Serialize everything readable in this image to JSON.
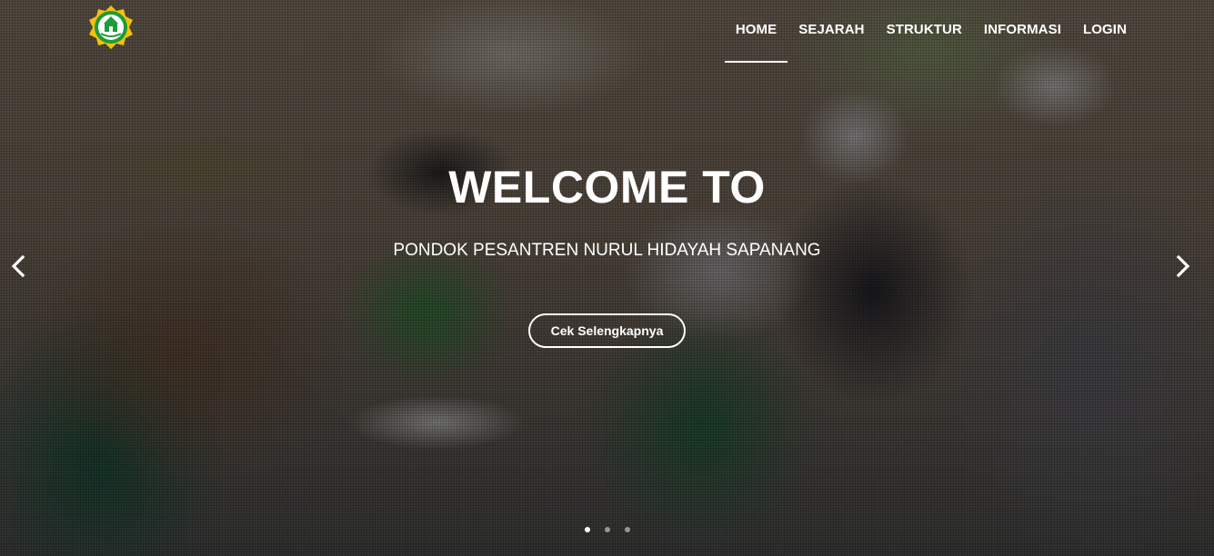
{
  "nav": {
    "items": [
      {
        "label": "HOME",
        "active": true
      },
      {
        "label": "SEJARAH",
        "active": false
      },
      {
        "label": "STRUKTUR",
        "active": false
      },
      {
        "label": "INFORMASI",
        "active": false
      },
      {
        "label": "LOGIN",
        "active": false
      }
    ]
  },
  "hero": {
    "title": "WELCOME TO",
    "subtitle": "PONDOK PESANTREN NURUL HIDAYAH SAPANANG",
    "button_label": "Cek Selengkapnya"
  },
  "carousel": {
    "prev_icon": "chevron-left-icon",
    "next_icon": "chevron-right-icon",
    "slide_count": 3,
    "active_slide": 1
  },
  "colors": {
    "logo_green": "#1e9a3a",
    "logo_yellow": "#f2c20a",
    "text": "#ffffff"
  }
}
